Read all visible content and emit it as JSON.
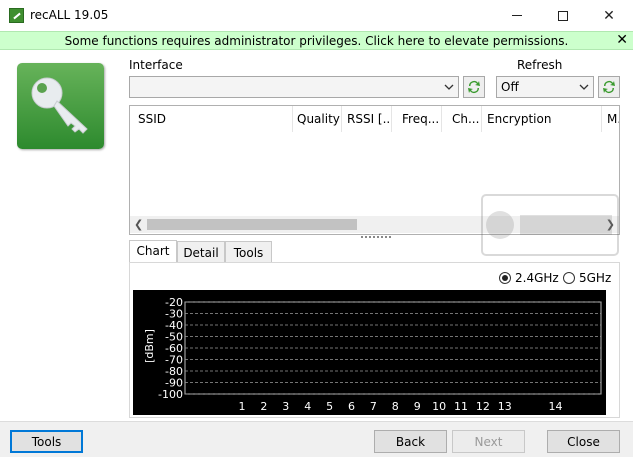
{
  "window": {
    "title": "recALL 19.05"
  },
  "banner": {
    "text": "Some functions requires administrator privileges. Click here to elevate permissions.",
    "close_glyph": "✕"
  },
  "interface": {
    "label": "Interface",
    "value": ""
  },
  "refresh": {
    "label": "Refresh",
    "value": "Off"
  },
  "columns": [
    {
      "label": "SSID"
    },
    {
      "label": "Quality"
    },
    {
      "label": "RSSI [..."
    },
    {
      "label": "Freq..."
    },
    {
      "label": "Ch..."
    },
    {
      "label": "Encryption"
    },
    {
      "label": "M."
    }
  ],
  "tabs": [
    {
      "label": "Chart",
      "active": true
    },
    {
      "label": "Detail",
      "active": false
    },
    {
      "label": "Tools",
      "active": false
    }
  ],
  "band": {
    "options": [
      {
        "label": "2.4GHz",
        "selected": true
      },
      {
        "label": "5GHz",
        "selected": false
      }
    ]
  },
  "chart_data": {
    "type": "line",
    "ylabel": "[dBm]",
    "xlabel": "",
    "title": "",
    "yticks": [
      "-20",
      "-30",
      "-40",
      "-50",
      "-60",
      "-70",
      "-80",
      "-90",
      "-100"
    ],
    "yvalues": [
      -20,
      -30,
      -40,
      -50,
      -60,
      -70,
      -80,
      -90,
      -100
    ],
    "ylim": [
      -100,
      -20
    ],
    "xticks": [
      1,
      2,
      3,
      4,
      5,
      6,
      7,
      8,
      9,
      10,
      11,
      12,
      13,
      14
    ],
    "xlim": [
      1,
      14
    ],
    "grid": true,
    "background": "#000000",
    "series": []
  },
  "buttons": {
    "tools": "Tools",
    "back": "Back",
    "next": "Next",
    "close": "Close"
  },
  "colors": {
    "banner_bg": "#ccffcc",
    "accent": "#0078d7",
    "key_tile": "#3f9a3a"
  },
  "icons": {
    "app": "key-icon",
    "refresh": "refresh-icon",
    "dropdown": "chevron-down-icon"
  }
}
